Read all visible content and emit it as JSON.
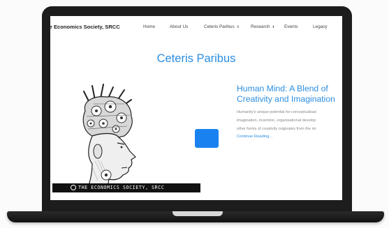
{
  "nav": {
    "brand": "he Economics Society, SRCC",
    "items": [
      {
        "label": "Home",
        "caret": false
      },
      {
        "label": "About Us",
        "caret": false
      },
      {
        "label": "Ceteris Paribus",
        "caret": true
      },
      {
        "label": "Research",
        "caret": true
      },
      {
        "label": "Events",
        "caret": false
      },
      {
        "label": "Legacy",
        "caret": false
      }
    ]
  },
  "page": {
    "title": "Ceteris Paribus"
  },
  "illustration": {
    "caption": "THE ECONOMICS SOCIETY, SRCC"
  },
  "article": {
    "title_line1": "Human Mind: A Blend of",
    "title_line2": "Creativity and Imagination",
    "excerpt_line1": "Humanity's unique potential for conceptualisat",
    "excerpt_line2": "imagination, invention, organisational develop",
    "excerpt_line3": "other forms of creativity originates from the mi",
    "read_more": "Continue Reading..."
  },
  "colors": {
    "accent": "#2b8ee0",
    "button": "#1a82f0",
    "laptop": "#1d1d1d"
  }
}
